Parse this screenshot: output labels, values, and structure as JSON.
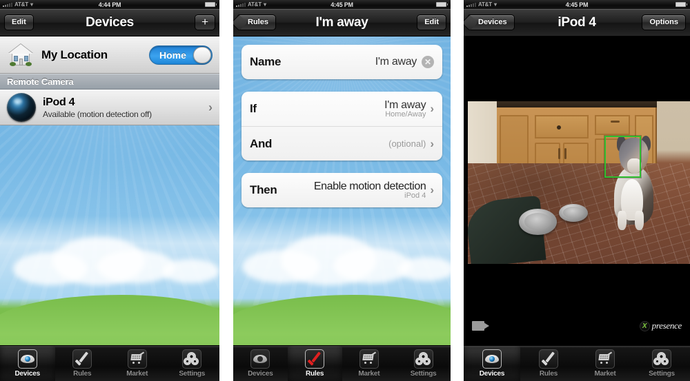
{
  "status_bar": {
    "carrier": "AT&T",
    "time_1": "4:44 PM",
    "time_2": "4:45 PM",
    "time_3": "4:45 PM",
    "signal_icon": "signal-bars-icon",
    "wifi_icon": "wifi-icon",
    "battery_icon": "battery-icon"
  },
  "panel1": {
    "nav": {
      "left_button": "Edit",
      "title": "Devices",
      "right_button": "+"
    },
    "location_row": {
      "icon": "house-icon",
      "label": "My Location",
      "toggle_label": "Home",
      "toggle_on": true
    },
    "section_header": "Remote Camera",
    "device_row": {
      "icon": "camera-lens-icon",
      "title": "iPod 4",
      "subtitle": "Available (motion detection off)",
      "chevron": "›"
    }
  },
  "panel2": {
    "nav": {
      "left_button": "Rules",
      "title": "I'm away",
      "right_button": "Edit"
    },
    "rows": [
      {
        "label": "Name",
        "value": "I'm away",
        "sub": "",
        "accessory": "clear",
        "clear_glyph": "✕"
      },
      {
        "label": "If",
        "value": "I'm away",
        "sub": "Home/Away",
        "accessory": "chevron",
        "chevron": "›"
      },
      {
        "label": "And",
        "value": "(optional)",
        "sub": "",
        "accessory": "chevron",
        "chevron": "›"
      },
      {
        "label": "Then",
        "value": "Enable motion detection",
        "sub": "iPod 4",
        "accessory": "chevron",
        "chevron": "›"
      }
    ]
  },
  "panel3": {
    "nav": {
      "left_button": "Devices",
      "title": "iPod 4",
      "right_button": "Options"
    },
    "video": {
      "scene_description": "Live camera view of a dog sitting on a brick kitchen floor next to two metal bowls in front of wooden cabinets",
      "detection_box_color": "#2fbf2f",
      "detection_label": "face-detection-box"
    },
    "record_button_icon": "video-camera-icon",
    "brand": {
      "mark": "presence-logo-icon",
      "word": "presence"
    }
  },
  "tabs": [
    {
      "label": "Devices",
      "icon": "eye-icon"
    },
    {
      "label": "Rules",
      "icon": "checkmark-icon"
    },
    {
      "label": "Market",
      "icon": "shopping-cart-icon"
    },
    {
      "label": "Settings",
      "icon": "gears-icon"
    }
  ],
  "selected_tab": {
    "panel1": "Devices",
    "panel2": "Rules",
    "panel3": "Devices"
  },
  "colors": {
    "accent_blue": "#3ca3ef",
    "nav_black": "#1f1f1f",
    "detection_green": "#2fbf2f",
    "brand_green": "#7dc63f",
    "sky": "#72b6e4",
    "grass": "#7fc350"
  }
}
